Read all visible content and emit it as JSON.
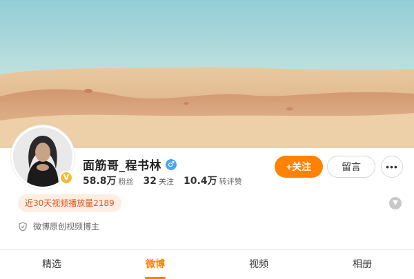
{
  "profile": {
    "name": "面筋哥_程书林",
    "gender_icon": "male-icon",
    "verified_icon": "verified-v-icon"
  },
  "stats": [
    {
      "value": "58.8万",
      "label": "粉丝"
    },
    {
      "value": "32",
      "label": "关注"
    },
    {
      "value": "10.4万",
      "label": "转评赞"
    }
  ],
  "actions": {
    "follow_label": "+关注",
    "message_label": "留言",
    "more_label": "•••"
  },
  "play_badge": "近30天视频播放量2189",
  "description": "微博原创视频博主",
  "tabs": [
    {
      "label": "精选",
      "active": false
    },
    {
      "label": "微博",
      "active": true
    },
    {
      "label": "视频",
      "active": false
    },
    {
      "label": "相册",
      "active": false
    }
  ],
  "colors": {
    "accent": "#ff8200",
    "badge_text": "#e2541b",
    "badge_bg": "#fdeee4",
    "gender": "#4aa6ee",
    "verified": "#f4b93a"
  }
}
